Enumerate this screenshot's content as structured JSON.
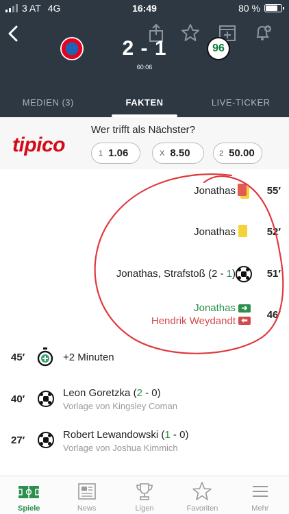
{
  "status": {
    "carrier": "3 AT",
    "network": "4G",
    "time": "16:49",
    "battery": "80 %",
    "battery_level": 0.8
  },
  "match": {
    "home_score": "2",
    "separator": "-",
    "away_score": "1",
    "clock": "60:06",
    "away_crest_text": "96"
  },
  "tabs": [
    {
      "label": "MEDIEN (3)",
      "active": false
    },
    {
      "label": "FAKTEN",
      "active": true
    },
    {
      "label": "LIVE-TICKER",
      "active": false
    }
  ],
  "betting": {
    "brand": "tipico",
    "question": "Wer trifft als Nächster?",
    "odds": [
      {
        "key": "1",
        "value": "1.06"
      },
      {
        "key": "X",
        "value": "8.50"
      },
      {
        "key": "2",
        "value": "50.00"
      }
    ]
  },
  "events_away": {
    "red_card": {
      "player": "Jonathas",
      "minute": "55′"
    },
    "yellow_card": {
      "player": "Jonathas",
      "minute": "52′"
    },
    "goal": {
      "player": "Jonathas, Strafstoß",
      "score_open": "(2 - ",
      "score_highlight": "1",
      "score_close": ")",
      "minute": "51′"
    },
    "substitution": {
      "player_in": "Jonathas",
      "player_out": "Hendrik Weydandt",
      "minute": "46′"
    }
  },
  "events_home": {
    "stoppage": {
      "minute": "45′",
      "text": "+2 Minuten"
    },
    "goal_goretzka": {
      "minute": "40′",
      "player": "Leon Goretzka",
      "score_open": "(",
      "score_highlight": "2",
      "score_close": " - 0)",
      "assist": "Vorlage von Kingsley Coman"
    },
    "goal_lewandowski": {
      "minute": "27′",
      "player": "Robert Lewandowski",
      "score_open": "(",
      "score_highlight": "1",
      "score_close": " - 0)",
      "assist": "Vorlage von Joshua Kimmich"
    }
  },
  "nav": [
    {
      "label": "Spiele",
      "icon": "pitch-icon",
      "active": true
    },
    {
      "label": "News",
      "icon": "newspaper-icon",
      "active": false
    },
    {
      "label": "Ligen",
      "icon": "trophy-icon",
      "active": false
    },
    {
      "label": "Favoriten",
      "icon": "star-icon",
      "active": false
    },
    {
      "label": "Mehr",
      "icon": "menu-icon",
      "active": false
    }
  ],
  "colors": {
    "header": "#2d3843",
    "accent_green": "#2c8f4d",
    "accent_red": "#d24b4b",
    "tipico_red": "#d40a18",
    "annotation_red": "#e0393e"
  }
}
